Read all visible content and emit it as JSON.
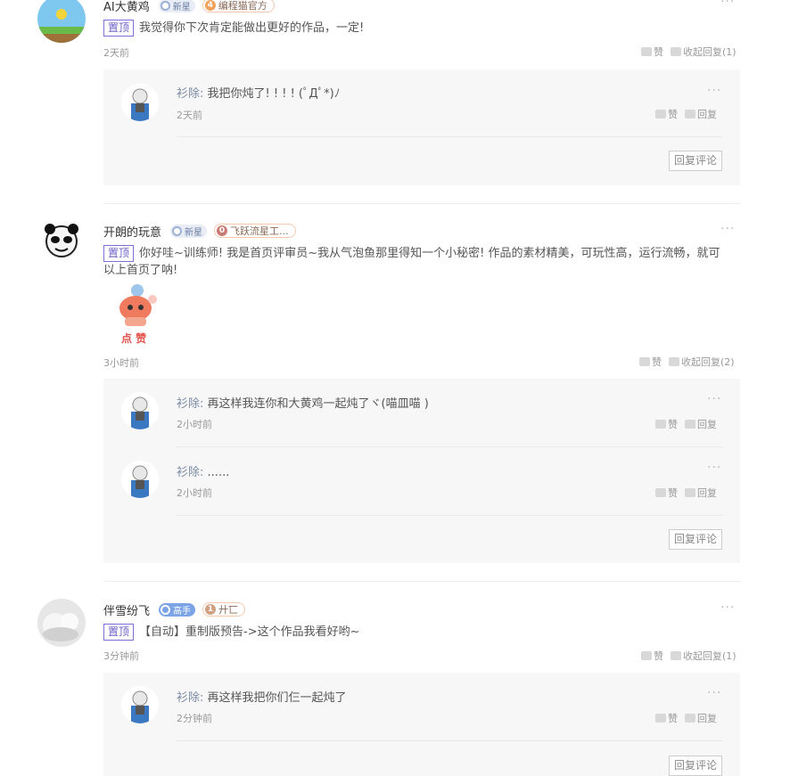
{
  "comments": [
    {
      "user": "AI大黄鸡",
      "level_badge": "新星",
      "tag_num": "4",
      "tag_text": "编程猫官方",
      "pin": "置顶",
      "text": "我觉得你下次肯定能做出更好的作品，一定!",
      "time": "2天前",
      "like": "赞",
      "collapse": "收起回复(1)",
      "replies": [
        {
          "user": "衫除",
          "sep": ":",
          "text": "我把你炖了! ! ! ! (ﾟДﾟ*)ﾉ",
          "time": "2天前",
          "like": "赞",
          "reply": "回复"
        }
      ],
      "reply_button": "回复评论"
    },
    {
      "user": "开朗的玩意",
      "level_badge": "新星",
      "tag_num": "0",
      "tag_text": "飞跃流星工...",
      "pin": "置顶",
      "text": "你好哇~训练师! 我是首页评审员~我从气泡鱼那里得知一个小秘密! 作品的素材精美，可玩性高，运行流畅，就可以上首页了呐!",
      "sticker_label": "点 赞",
      "time": "3小时前",
      "like": "赞",
      "collapse": "收起回复(2)",
      "replies": [
        {
          "user": "衫除",
          "sep": ":",
          "text": "再这样我连你和大黄鸡一起炖了ヾ(喵皿喵 )",
          "time": "2小时前",
          "like": "赞",
          "reply": "回复"
        },
        {
          "user": "衫除",
          "sep": ":",
          "text": "......",
          "time": "2小时前",
          "like": "赞",
          "reply": "回复"
        }
      ],
      "reply_button": "回复评论"
    },
    {
      "user": "伴雪纷飞",
      "level_badge": "高手",
      "tag_num": "1",
      "tag_text": "廾匸",
      "pin": "置顶",
      "text": "【自动】重制版预告->这个作品我看好哟~",
      "time": "3分钟前",
      "like": "赞",
      "collapse": "收起回复(1)",
      "replies": [
        {
          "user": "衫除",
          "sep": ":",
          "text": "再这样我把你们仨一起炖了",
          "time": "2分钟前",
          "like": "赞",
          "reply": "回复"
        }
      ],
      "reply_button": "回复评论"
    }
  ],
  "more_glyph": "···",
  "colors": {
    "pin_border": "#7a6ed9",
    "reply_bg": "#f7f7f7",
    "accent_badge": "#7ba4e6"
  }
}
